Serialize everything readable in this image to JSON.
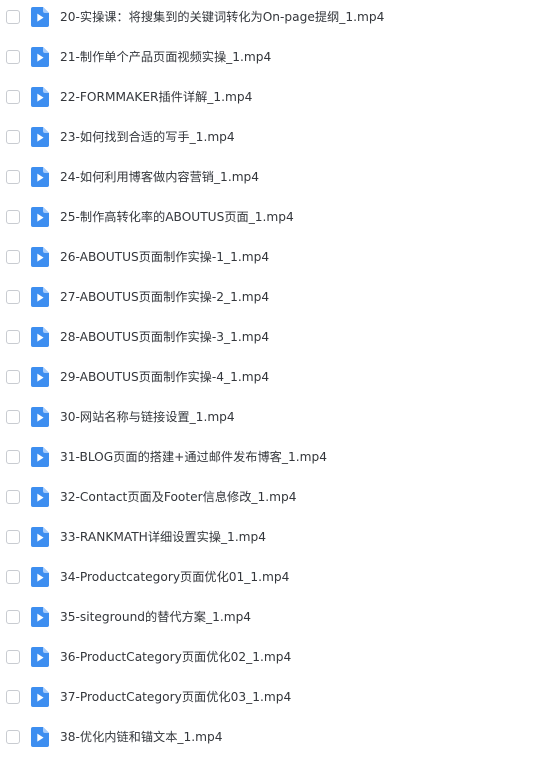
{
  "files": [
    {
      "name": "20-实操课：将搜集到的关键词转化为On-page提纲_1.mp4",
      "icon": "video-file-icon"
    },
    {
      "name": "21-制作单个产品页面视频实操_1.mp4",
      "icon": "video-file-icon"
    },
    {
      "name": "22-FORMMAKER插件详解_1.mp4",
      "icon": "video-file-icon"
    },
    {
      "name": "23-如何找到合适的写手_1.mp4",
      "icon": "video-file-icon"
    },
    {
      "name": "24-如何利用博客做内容营销_1.mp4",
      "icon": "video-file-icon"
    },
    {
      "name": "25-制作高转化率的ABOUTUS页面_1.mp4",
      "icon": "video-file-icon"
    },
    {
      "name": "26-ABOUTUS页面制作实操-1_1.mp4",
      "icon": "video-file-icon"
    },
    {
      "name": "27-ABOUTUS页面制作实操-2_1.mp4",
      "icon": "video-file-icon"
    },
    {
      "name": "28-ABOUTUS页面制作实操-3_1.mp4",
      "icon": "video-file-icon"
    },
    {
      "name": "29-ABOUTUS页面制作实操-4_1.mp4",
      "icon": "video-file-icon"
    },
    {
      "name": "30-网站名称与链接设置_1.mp4",
      "icon": "video-file-icon"
    },
    {
      "name": "31-BLOG页面的搭建+通过邮件发布博客_1.mp4",
      "icon": "video-file-icon"
    },
    {
      "name": "32-Contact页面及Footer信息修改_1.mp4",
      "icon": "video-file-icon"
    },
    {
      "name": "33-RANKMATH详细设置实操_1.mp4",
      "icon": "video-file-icon"
    },
    {
      "name": "34-Productcategory页面优化01_1.mp4",
      "icon": "video-file-icon"
    },
    {
      "name": "35-siteground的替代方案_1.mp4",
      "icon": "video-file-icon"
    },
    {
      "name": "36-ProductCategory页面优化02_1.mp4",
      "icon": "video-file-icon"
    },
    {
      "name": "37-ProductCategory页面优化03_1.mp4",
      "icon": "video-file-icon"
    },
    {
      "name": "38-优化内链和锚文本_1.mp4",
      "icon": "video-file-icon"
    }
  ],
  "colors": {
    "icon_blue": "#3d8ef0",
    "icon_fold": "#a9cdfa",
    "text": "#33363b",
    "checkbox_border": "#c9ccd1"
  }
}
